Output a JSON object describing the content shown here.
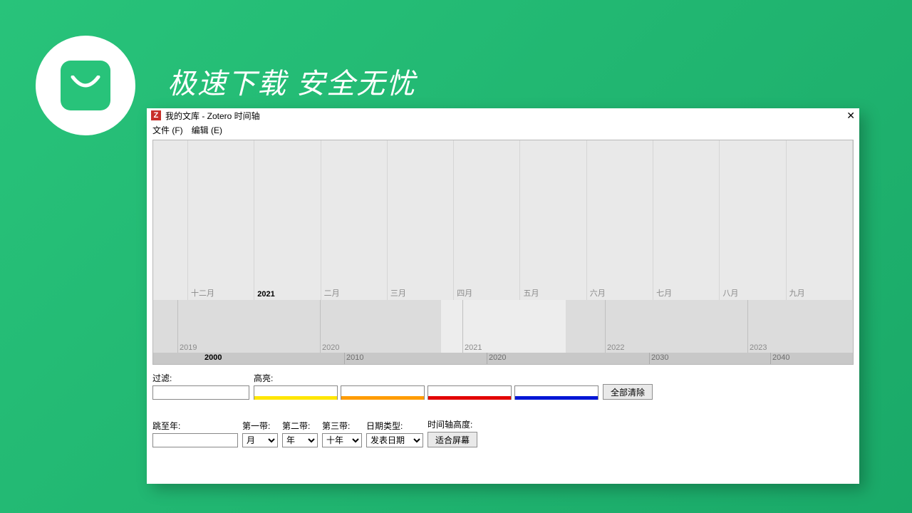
{
  "banner": {
    "text": "极速下载  安全无忧"
  },
  "window": {
    "title": "我的文库 - Zotero 时间轴",
    "menu": {
      "file": "文件 (F)",
      "edit": "编辑 (E)"
    }
  },
  "timeline": {
    "top_year": "2021",
    "top_labels": [
      "十二月",
      "2021",
      "二月",
      "三月",
      "四月",
      "五月",
      "六月",
      "七月",
      "八月",
      "九月"
    ],
    "mid_labels": [
      "2019",
      "2020",
      "2021",
      "2022",
      "2023"
    ],
    "bot_year_strong": "2000",
    "bot_labels": [
      "2010",
      "2020",
      "2030",
      "2040"
    ]
  },
  "controls": {
    "filter_label": "过滤:",
    "highlight_label": "高亮:",
    "clear_all": "全部清除",
    "jump_label": "跳至年:",
    "band1_label": "第一带:",
    "band2_label": "第二带:",
    "band3_label": "第三带:",
    "date_type_label": "日期类型:",
    "height_label": "时间轴高度:",
    "band1_val": "月",
    "band2_val": "年",
    "band3_val": "十年",
    "date_type_val": "发表日期",
    "fit_screen": "适合屏幕",
    "hl_colors": [
      "#ffe600",
      "#ff9c00",
      "#e30000",
      "#0016d6"
    ]
  }
}
